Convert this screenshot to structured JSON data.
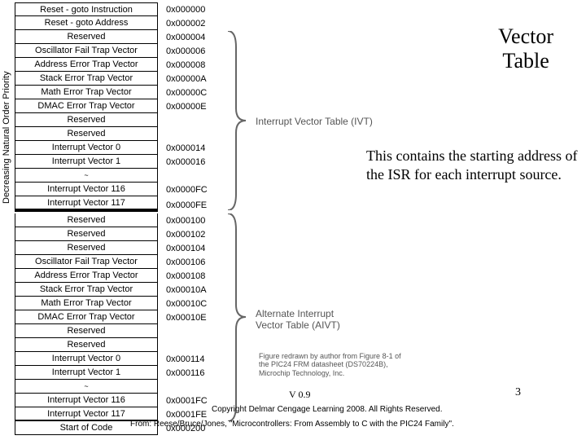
{
  "axis_label": "Decreasing Natural Order Priority",
  "title": "Vector",
  "title2": "Table",
  "description": "This contains the starting address of the ISR for each interrupt source.",
  "ivt_label": "Interrupt Vector Table (IVT)",
  "aivt_label1": "Alternate Interrupt",
  "aivt_label2": "Vector Table (AIVT)",
  "caption1": "Figure redrawn by author from Figure 8-1 of",
  "caption2": "the PIC24 FRM datasheet (DS70224B),",
  "caption3": "Microchip Technology, Inc.",
  "version": "V 0.9",
  "page": "3",
  "copyright": "Copyright Delmar Cengage Learning 2008. All Rights Reserved.",
  "source": "From: Reese/Bruce/Jones, \"Microcontrollers: From Assembly to C with the PIC24 Family\".",
  "rows": {
    "r0": "Reset - goto Instruction",
    "a0": "0x000000",
    "r1": "Reset - goto Address",
    "a1": "0x000002",
    "r2": "Reserved",
    "a2": "0x000004",
    "r3": "Oscillator Fail Trap Vector",
    "a3": "0x000006",
    "r4": "Address Error Trap Vector",
    "a4": "0x000008",
    "r5": "Stack Error Trap Vector",
    "a5": "0x00000A",
    "r6": "Math Error Trap Vector",
    "a6": "0x00000C",
    "r7": "DMAC Error Trap Vector",
    "a7": "0x00000E",
    "r8": "Reserved",
    "a8": "",
    "r9": "Reserved",
    "a9": "",
    "r10": "Interrupt Vector 0",
    "a10": "0x000014",
    "r11": "Interrupt Vector 1",
    "a11": "0x000016",
    "r12": "~",
    "a12": "",
    "r13": "Interrupt Vector 116",
    "a13": "0x0000FC",
    "r14": "Interrupt Vector 117",
    "a14": "0x0000FE",
    "r15": "Reserved",
    "a15": "0x000100",
    "r16": "Reserved",
    "a16": "0x000102",
    "r17": "Reserved",
    "a17": "0x000104",
    "r18": "Oscillator Fail Trap Vector",
    "a18": "0x000106",
    "r19": "Address Error Trap Vector",
    "a19": "0x000108",
    "r20": "Stack Error Trap Vector",
    "a20": "0x00010A",
    "r21": "Math Error Trap Vector",
    "a21": "0x00010C",
    "r22": "DMAC Error Trap Vector",
    "a22": "0x00010E",
    "r23": "Reserved",
    "a23": "",
    "r24": "Reserved",
    "a24": "",
    "r25": "Interrupt Vector 0",
    "a25": "0x000114",
    "r26": "Interrupt Vector 1",
    "a26": "0x000116",
    "r27": "~",
    "a27": "",
    "r28": "Interrupt Vector 116",
    "a28": "0x0001FC",
    "r29": "Interrupt Vector 117",
    "a29": "0x0001FE",
    "r30": "Start of Code",
    "a30": "0x000200"
  }
}
